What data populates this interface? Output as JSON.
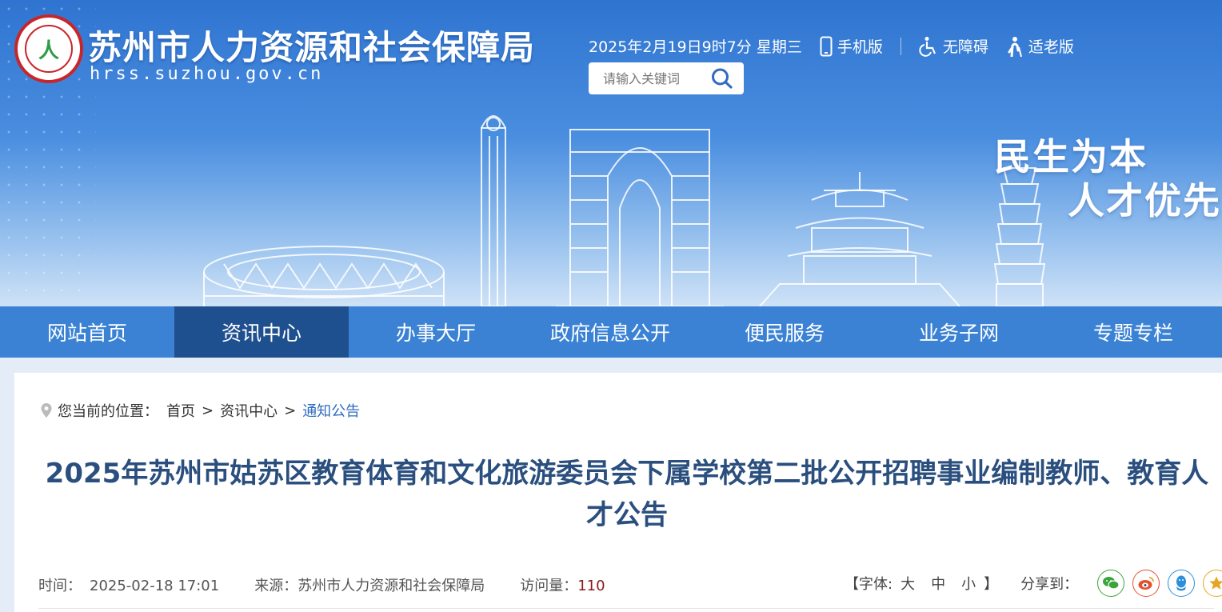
{
  "header": {
    "site_title": "苏州市人力资源和社会保障局",
    "site_url": "hrss.suzhou.gov.cn",
    "datetime": "2025年2月19日9时7分 星期三",
    "mobile_label": "手机版",
    "accessibility_label": "无障碍",
    "elderly_label": "适老版",
    "search_placeholder": "请输入关键词",
    "slogan_line1": "民生为本",
    "slogan_line2": "人才优先"
  },
  "nav": {
    "tabs": [
      {
        "label": "网站首页"
      },
      {
        "label": "资讯中心",
        "active": true
      },
      {
        "label": "办事大厅"
      },
      {
        "label": "政府信息公开"
      },
      {
        "label": "便民服务"
      },
      {
        "label": "业务子网"
      },
      {
        "label": "专题专栏"
      }
    ]
  },
  "breadcrumb": {
    "prefix": "您当前的位置：",
    "items": [
      "首页",
      "资讯中心",
      "通知公告"
    ],
    "separator": ">"
  },
  "article": {
    "title": "2025年苏州市姑苏区教育体育和文化旅游委员会下属学校第二批公开招聘事业编制教师、教育人才公告",
    "time_label": "时间：",
    "time_value": "2025-02-18 17:01",
    "source_label": "来源：",
    "source_value": "苏州市人力资源和社会保障局",
    "views_label": "访问量：",
    "views_value": "110",
    "font_prefix": "【字体:",
    "font_large": "大",
    "font_medium": "中",
    "font_small": "小",
    "font_suffix": "】",
    "share_label": "分享到："
  },
  "share_icons": [
    {
      "name": "wechat-icon",
      "color": "#3aa53a"
    },
    {
      "name": "weibo-icon",
      "color": "#e5512f"
    },
    {
      "name": "qq-icon",
      "color": "#2c8fdc"
    },
    {
      "name": "favorite-icon",
      "color": "#e5a722"
    }
  ],
  "colors": {
    "nav_bg": "#3b82d4",
    "nav_active": "#1e4f8f",
    "title_color": "#2a4f7e",
    "breadcrumb_current": "#2f6bc0"
  }
}
